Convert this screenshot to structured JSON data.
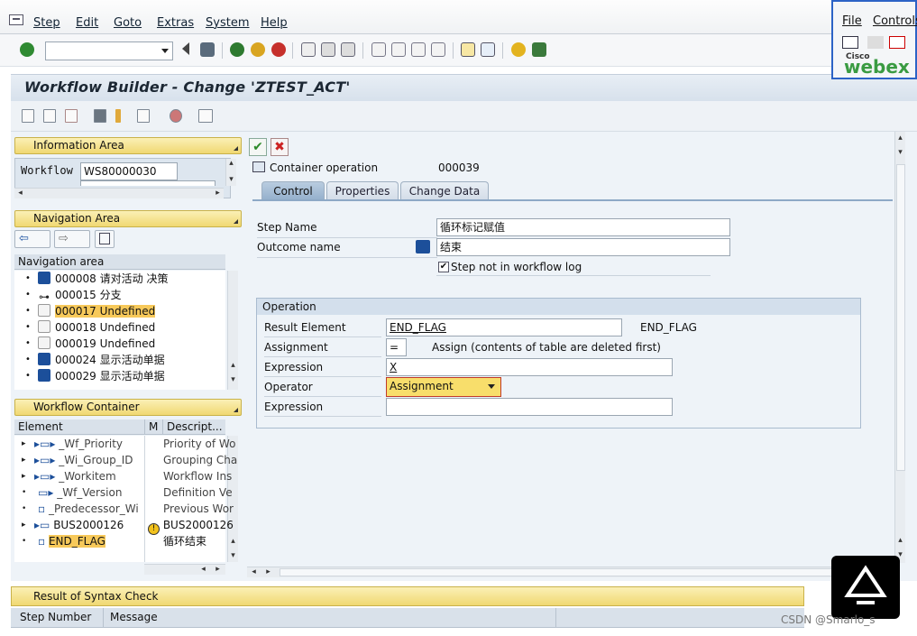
{
  "menubar": {
    "items": [
      "Step",
      "Edit",
      "Goto",
      "Extras",
      "System",
      "Help"
    ]
  },
  "title": "Workflow Builder - Change 'ZTEST_ACT'",
  "info_area": {
    "header": "Information Area",
    "workflow_label": "Workflow",
    "workflow_value": "WS80000030"
  },
  "nav_area": {
    "header": "Navigation Area",
    "column": "Navigation area",
    "rows": [
      {
        "id": "000008",
        "text": "请对活动 决策",
        "icon": "blue"
      },
      {
        "id": "000015",
        "text": "分支",
        "icon": "fork"
      },
      {
        "id": "000017",
        "text": "Undefined",
        "icon": "doc"
      },
      {
        "id": "000018",
        "text": "Undefined",
        "icon": "doc"
      },
      {
        "id": "000019",
        "text": "Undefined",
        "icon": "doc"
      },
      {
        "id": "000024",
        "text": "显示活动单据",
        "icon": "blue"
      },
      {
        "id": "000029",
        "text": "显示活动单据",
        "icon": "blue"
      }
    ]
  },
  "container": {
    "header": "Workflow Container",
    "col_element": "Element",
    "col_m": "M",
    "col_desc": "Descript...",
    "rows": [
      {
        "name": "_Wf_Priority",
        "desc": "Priority of Wo"
      },
      {
        "name": "_Wi_Group_ID",
        "desc": "Grouping Cha"
      },
      {
        "name": "_Workitem",
        "desc": "Workflow Ins"
      },
      {
        "name": "_Wf_Version",
        "desc": "Definition Ve"
      },
      {
        "name": "_Predecessor_Wi",
        "desc": "Previous Wor"
      },
      {
        "name": "BUS2000126",
        "desc": "BUS2000126"
      },
      {
        "name": "END_FLAG",
        "desc": "循环结束"
      }
    ]
  },
  "step": {
    "type_label": "Container operation",
    "number": "000039",
    "tabs": [
      "Control",
      "Properties",
      "Change Data"
    ],
    "step_name_label": "Step Name",
    "step_name_value": "循环标记赋值",
    "outcome_label": "Outcome name",
    "outcome_value": "结束",
    "log_checkbox_label": "Step not in workflow log"
  },
  "operation": {
    "header": "Operation",
    "result_label": "Result Element",
    "result_value": "END_FLAG",
    "result_desc": "END_FLAG",
    "assignment_label": "Assignment",
    "assignment_value": "=",
    "assignment_desc": "Assign (contents of table are deleted first)",
    "expression_label": "Expression",
    "expression_value": "X",
    "operator_label": "Operator",
    "operator_value": "Assignment",
    "expression2_label": "Expression",
    "expression2_value": ""
  },
  "bottom": {
    "syntax_header": "Result of Syntax Check",
    "col_step": "Step Number",
    "col_message": "Message"
  },
  "webex": {
    "menu_file": "File",
    "menu_controls": "Controls",
    "brand_small": "Cisco",
    "brand": "webex"
  },
  "watermark": "CSDN @Smarlo_s"
}
